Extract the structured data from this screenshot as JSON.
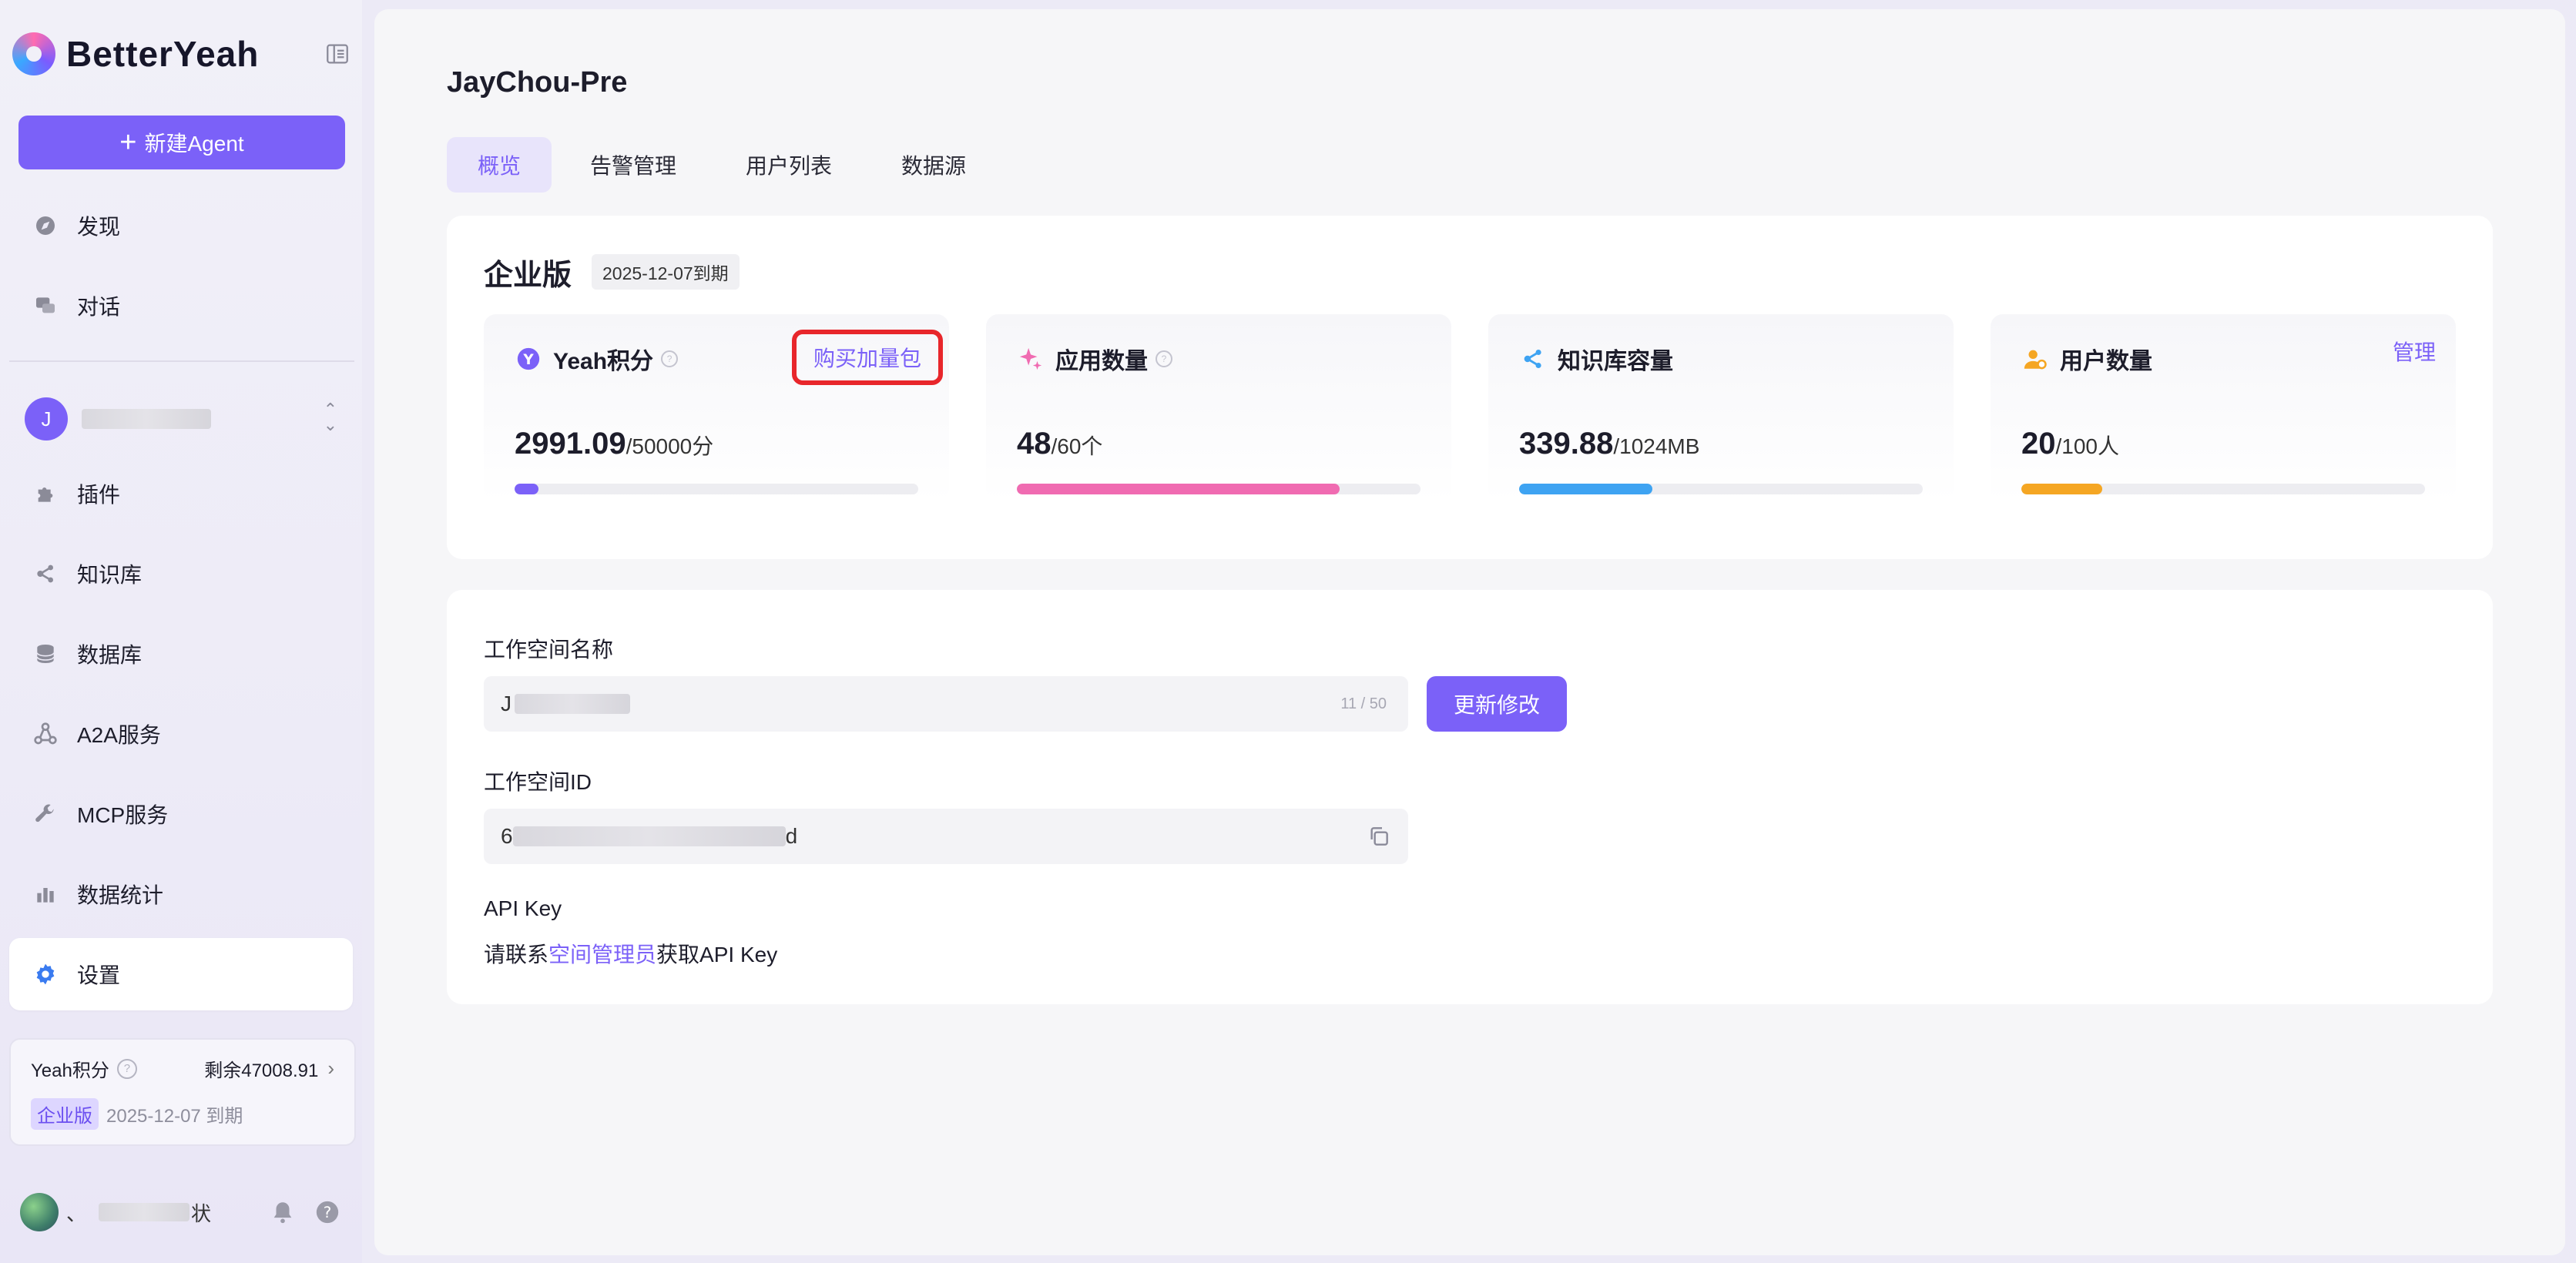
{
  "app": {
    "brand": "BetterYeah"
  },
  "sidebar": {
    "new_agent_label": "新建Agent",
    "items": [
      {
        "label": "发现",
        "icon": "compass-icon"
      },
      {
        "label": "对话",
        "icon": "chat-icon"
      },
      {
        "label": "插件",
        "icon": "puzzle-icon"
      },
      {
        "label": "知识库",
        "icon": "share-nodes-icon"
      },
      {
        "label": "数据库",
        "icon": "database-icon"
      },
      {
        "label": "A2A服务",
        "icon": "network-icon"
      },
      {
        "label": "MCP服务",
        "icon": "wrench-icon"
      },
      {
        "label": "数据统计",
        "icon": "bar-chart-icon"
      },
      {
        "label": "设置",
        "icon": "gear-icon",
        "active": true
      }
    ],
    "workspace": {
      "avatar_letter": "J"
    },
    "points_card": {
      "label": "Yeah积分",
      "remaining": "剩余47008.91",
      "edition": "企业版",
      "expire": "2025-12-07 到期"
    },
    "user": {
      "name_tail": "、",
      "name_end": "状"
    }
  },
  "main": {
    "title": "JayChou-Pre",
    "tabs": [
      {
        "label": "概览",
        "active": true
      },
      {
        "label": "告警管理"
      },
      {
        "label": "用户列表"
      },
      {
        "label": "数据源"
      }
    ],
    "edition": {
      "title": "企业版",
      "expire_tag": "2025-12-07到期"
    },
    "stats": [
      {
        "title": "Yeah积分",
        "action": "购买加量包",
        "value": "2991.09",
        "unit": "/50000分",
        "fill": 0.06,
        "color": "#7b61f8"
      },
      {
        "title": "应用数量",
        "value": "48",
        "unit": "/60个",
        "fill": 0.8,
        "color": "#f06bb1"
      },
      {
        "title": "知识库容量",
        "value": "339.88",
        "unit": "/1024MB",
        "fill": 0.33,
        "color": "#3ea3f2"
      },
      {
        "title": "用户数量",
        "action": "管理",
        "value": "20",
        "unit": "/100人",
        "fill": 0.2,
        "color": "#f5a623"
      }
    ],
    "workspace_name": {
      "label": "工作空间名称",
      "value_prefix": "J",
      "counter": "11 / 50",
      "button": "更新修改"
    },
    "workspace_id": {
      "label": "工作空间ID",
      "value_prefix": "6",
      "value_suffix": "d"
    },
    "api_key": {
      "label": "API Key",
      "tip_before": "请联系",
      "tip_link": "空间管理员",
      "tip_after": "获取API Key"
    }
  }
}
